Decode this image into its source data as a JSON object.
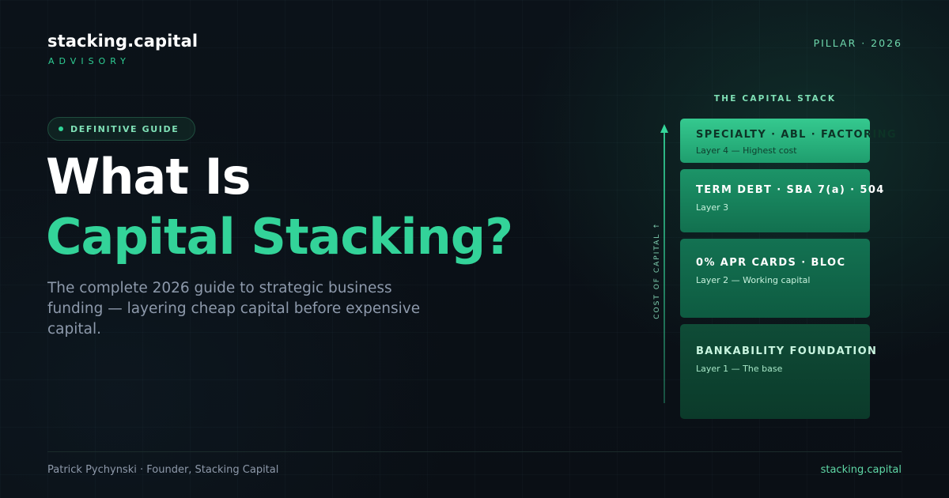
{
  "brand": {
    "name": "stacking.capital",
    "tagline": "ADVISORY"
  },
  "pillar_label": "PILLAR · 2026",
  "badge": {
    "label": "DEFINITIVE GUIDE"
  },
  "headline": {
    "line1": "What Is",
    "line2": "Capital Stacking?"
  },
  "subtitle": "The complete 2026 guide to strategic business funding — layering cheap capital before expensive capital.",
  "stack": {
    "title": "THE CAPITAL STACK",
    "axis_label": "COST OF CAPITAL ↑",
    "layers": [
      {
        "title": "SPECIALTY · ABL · FACTORING",
        "subtitle": "Layer 4 — Highest cost"
      },
      {
        "title": "TERM DEBT · SBA 7(a) · 504",
        "subtitle": "Layer 3"
      },
      {
        "title": "0% APR CARDS · BLOC",
        "subtitle": "Layer 2 — Working capital"
      },
      {
        "title": "BANKABILITY FOUNDATION",
        "subtitle": "Layer 1 — The base"
      }
    ]
  },
  "footer": {
    "author": "Patrick Pychynski · Founder, Stacking Capital",
    "site": "stacking.capital"
  },
  "colors": {
    "background": "#0a1016",
    "accent": "#33d399",
    "text_primary": "#ffffff",
    "text_muted": "#8d99ab"
  }
}
